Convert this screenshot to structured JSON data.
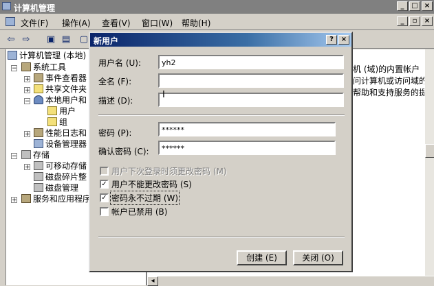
{
  "window": {
    "title": "计算机管理"
  },
  "menu": [
    "文件(F)",
    "操作(A)",
    "查看(V)",
    "窗口(W)",
    "帮助(H)"
  ],
  "tree": [
    {
      "label": "计算机管理 (本地)",
      "icon": "pc"
    },
    {
      "label": "系统工具",
      "icon": "tool"
    },
    {
      "label": "事件查看器",
      "icon": "tool"
    },
    {
      "label": "共享文件夹",
      "icon": "folder"
    },
    {
      "label": "本地用户和",
      "icon": "user"
    },
    {
      "label": "用户",
      "icon": "folder"
    },
    {
      "label": "组",
      "icon": "folder"
    },
    {
      "label": "性能日志和",
      "icon": "tool"
    },
    {
      "label": "设备管理器",
      "icon": "pc"
    },
    {
      "label": "存储",
      "icon": "disk"
    },
    {
      "label": "可移动存储",
      "icon": "disk"
    },
    {
      "label": "磁盘碎片整",
      "icon": "disk"
    },
    {
      "label": "磁盘管理",
      "icon": "disk"
    },
    {
      "label": "服务和应用程序",
      "icon": "tool"
    }
  ],
  "right_pane_text": [
    "机 (域)的内置帐户",
    "问计算机或访问域的",
    "帮助和支持服务的提"
  ],
  "dialog": {
    "title": "新用户",
    "username_label": "用户名 (U):",
    "username_value": "yh2",
    "fullname_label": "全名 (F):",
    "fullname_value": "",
    "desc_label": "描述 (D):",
    "desc_value": "",
    "password_label": "密码 (P):",
    "password_value": "******",
    "confirm_label": "确认密码 (C):",
    "confirm_value": "******",
    "checks": [
      {
        "label": "用户下次登录时须更改密码 (M)",
        "checked": false,
        "enabled": false
      },
      {
        "label": "用户不能更改密码 (S)",
        "checked": true,
        "enabled": true
      },
      {
        "label": "密码永不过期 (W)",
        "checked": true,
        "enabled": true
      },
      {
        "label": "帐户已禁用 (B)",
        "checked": false,
        "enabled": true
      }
    ],
    "create_button": "创建 (E)",
    "close_button": "关闭 (O)"
  }
}
